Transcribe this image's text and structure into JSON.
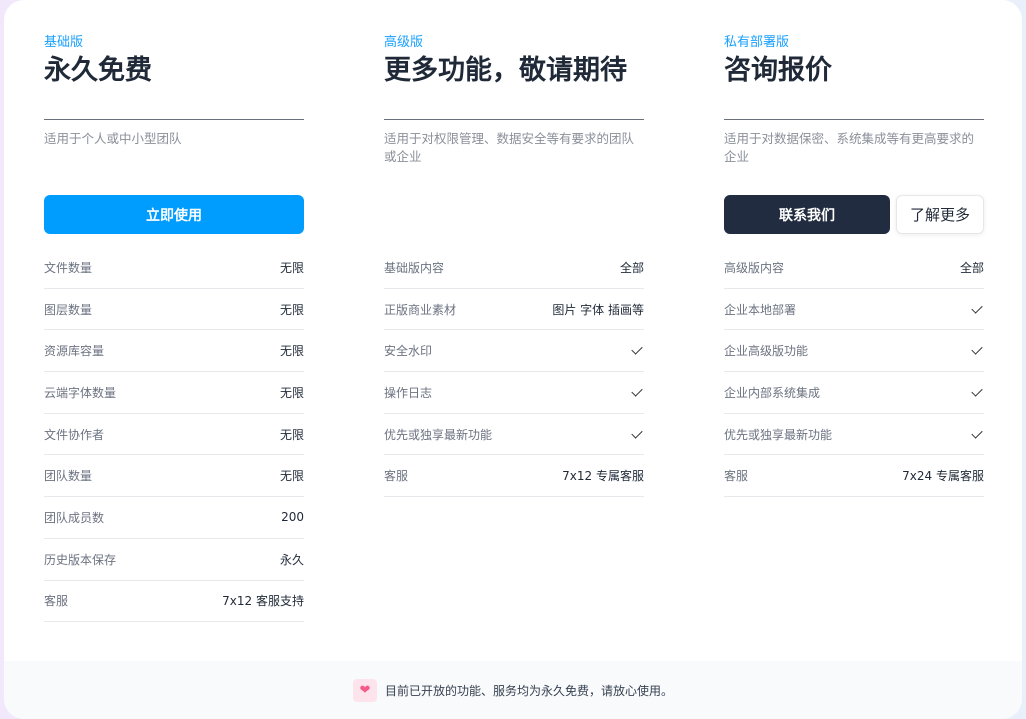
{
  "plans": [
    {
      "label": "基础版",
      "title": "永久免费",
      "desc": "适用于个人或中小型团队",
      "buttons": [
        {
          "text": "立即使用",
          "style": "primary"
        }
      ],
      "rows": [
        [
          "文件数量",
          "无限"
        ],
        [
          "图层数量",
          "无限"
        ],
        [
          "资源库容量",
          "无限"
        ],
        [
          "云端字体数量",
          "无限"
        ],
        [
          "文件协作者",
          "无限"
        ],
        [
          "团队数量",
          "无限"
        ],
        [
          "团队成员数",
          "200"
        ],
        [
          "历史版本保存",
          "永久"
        ],
        [
          "客服",
          "7x12 客服支持"
        ]
      ]
    },
    {
      "label": "高级版",
      "title": "更多功能，敬请期待",
      "desc": "适用于对权限管理、数据安全等有要求的团队或企业",
      "buttons": [],
      "rows": [
        [
          "基础版内容",
          "全部"
        ],
        [
          "正版商业素材",
          "图片 字体 插画等"
        ],
        [
          "安全水印",
          "check"
        ],
        [
          "操作日志",
          "check"
        ],
        [
          "优先或独享最新功能",
          "check"
        ],
        [
          "客服",
          "7x12 专属客服"
        ]
      ]
    },
    {
      "label": "私有部署版",
      "title": "咨询报价",
      "desc": "适用于对数据保密、系统集成等有更高要求的企业",
      "buttons": [
        {
          "text": "联系我们",
          "style": "dark"
        },
        {
          "text": "了解更多",
          "style": "light"
        }
      ],
      "rows": [
        [
          "高级版内容",
          "全部"
        ],
        [
          "企业本地部署",
          "check"
        ],
        [
          "企业高级版功能",
          "check"
        ],
        [
          "企业内部系统集成",
          "check"
        ],
        [
          "优先或独享最新功能",
          "check"
        ],
        [
          "客服",
          "7x24 专属客服"
        ]
      ]
    }
  ],
  "footer": {
    "icon": "heart-icon",
    "text": "目前已开放的功能、服务均为永久免费，请放心使用。"
  }
}
